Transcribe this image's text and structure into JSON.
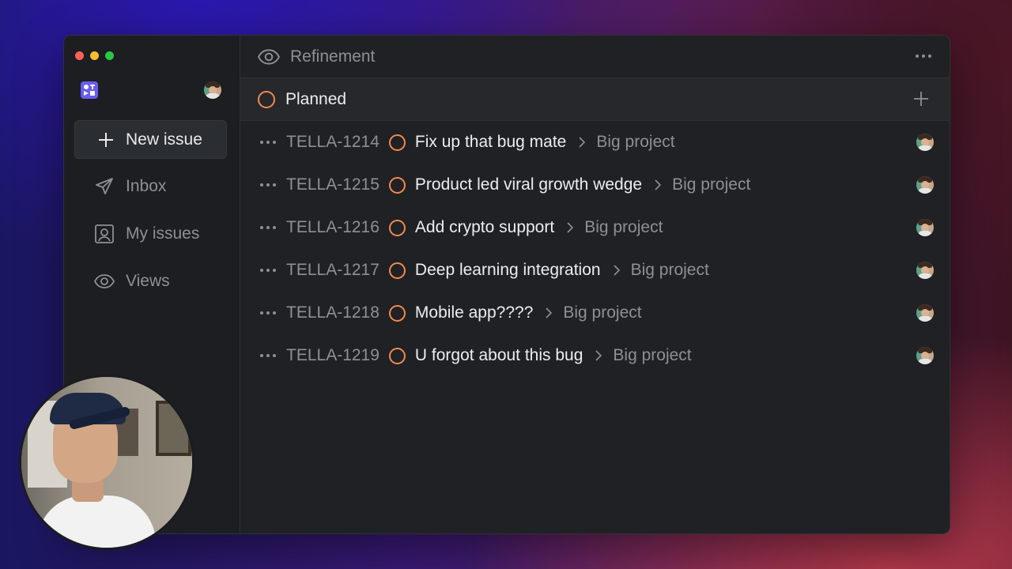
{
  "app": {
    "traffic_lights": [
      {
        "name": "close",
        "color": "#fe5f57"
      },
      {
        "name": "minimize",
        "color": "#febc2e"
      },
      {
        "name": "maximize",
        "color": "#28c840"
      }
    ],
    "logo_icon": "workspace-logo-icon",
    "accent_color": "#f08a4b"
  },
  "sidebar": {
    "new_issue_label": "New issue",
    "items": [
      {
        "label": "Inbox",
        "icon": "send-icon"
      },
      {
        "label": "My issues",
        "icon": "user-square-icon"
      },
      {
        "label": "Views",
        "icon": "eye-icon"
      }
    ]
  },
  "header": {
    "title": "Refinement",
    "icon": "eye-icon",
    "more_icon": "more-horizontal-icon"
  },
  "group": {
    "name": "Planned",
    "status_color": "#f08a4b"
  },
  "issues": [
    {
      "id": "TELLA-1214",
      "title": "Fix up that bug mate",
      "project": "Big project"
    },
    {
      "id": "TELLA-1215",
      "title": "Product led viral growth wedge",
      "project": "Big project"
    },
    {
      "id": "TELLA-1216",
      "title": "Add crypto support",
      "project": "Big project"
    },
    {
      "id": "TELLA-1217",
      "title": "Deep learning integration",
      "project": "Big project"
    },
    {
      "id": "TELLA-1218",
      "title": "Mobile app????",
      "project": "Big project"
    },
    {
      "id": "TELLA-1219",
      "title": "U forgot about this bug",
      "project": "Big project"
    }
  ]
}
